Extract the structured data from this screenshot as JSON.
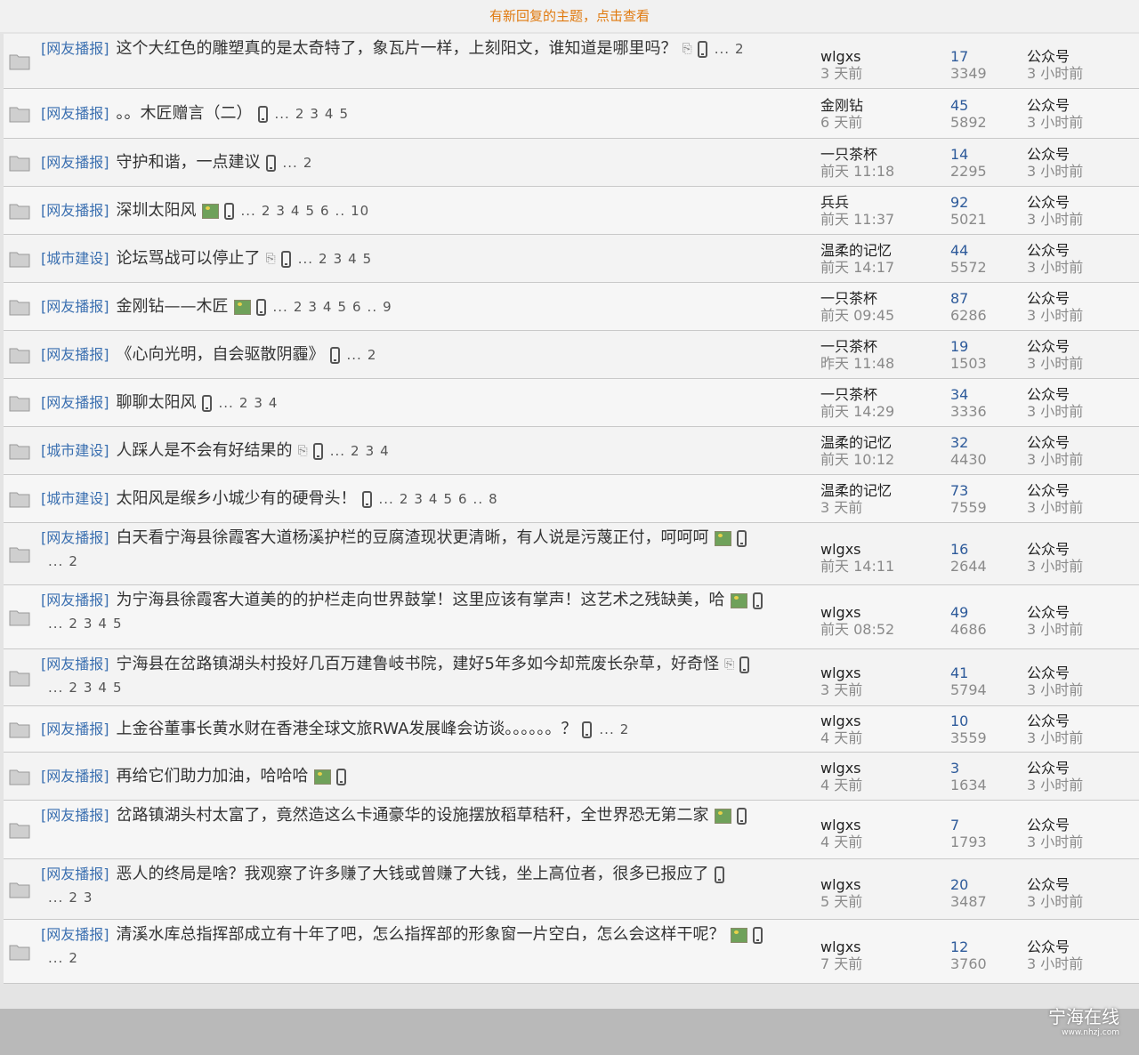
{
  "notice": "有新回复的主题，点击查看",
  "threads": [
    {
      "category": "[网友播报]",
      "title": "这个大红色的雕塑真的是太奇特了，象瓦片一样，上刻阳文，谁知道是哪里吗？",
      "icons": [
        "clip",
        "phone"
      ],
      "pages": [
        "...",
        "2"
      ],
      "author": "wlgxs",
      "author_time": "3 天前",
      "replies": "17",
      "views": "3349",
      "last_user": "公众号",
      "last_time": "3 小时前"
    },
    {
      "category": "[网友播报]",
      "title": "。。木匠赠言（二）",
      "icons": [
        "phone"
      ],
      "pages": [
        "...",
        "2",
        "3",
        "4",
        "5"
      ],
      "author": "金刚钻",
      "author_time": "6 天前",
      "replies": "45",
      "views": "5892",
      "last_user": "公众号",
      "last_time": "3 小时前"
    },
    {
      "category": "[网友播报]",
      "title": "守护和谐，一点建议",
      "icons": [
        "phone"
      ],
      "pages": [
        "...",
        "2"
      ],
      "author": "一只茶杯",
      "author_time": "前天 11:18",
      "replies": "14",
      "views": "2295",
      "last_user": "公众号",
      "last_time": "3 小时前"
    },
    {
      "category": "[网友播报]",
      "title": "深圳太阳风",
      "icons": [
        "img",
        "phone"
      ],
      "pages": [
        "...",
        "2",
        "3",
        "4",
        "5",
        "6",
        "..",
        "10"
      ],
      "author": "兵兵",
      "author_time": "前天 11:37",
      "replies": "92",
      "views": "5021",
      "last_user": "公众号",
      "last_time": "3 小时前"
    },
    {
      "category": "[城市建设]",
      "title": "论坛骂战可以停止了",
      "icons": [
        "clip",
        "phone"
      ],
      "pages": [
        "...",
        "2",
        "3",
        "4",
        "5"
      ],
      "author": "温柔的记忆",
      "author_time": "前天 14:17",
      "replies": "44",
      "views": "5572",
      "last_user": "公众号",
      "last_time": "3 小时前"
    },
    {
      "category": "[网友播报]",
      "title": "金刚钻——木匠",
      "icons": [
        "img",
        "phone"
      ],
      "pages": [
        "...",
        "2",
        "3",
        "4",
        "5",
        "6",
        "..",
        "9"
      ],
      "author": "一只茶杯",
      "author_time": "前天 09:45",
      "replies": "87",
      "views": "6286",
      "last_user": "公众号",
      "last_time": "3 小时前"
    },
    {
      "category": "[网友播报]",
      "title": "《心向光明，自会驱散阴霾》",
      "icons": [
        "phone"
      ],
      "pages": [
        "...",
        "2"
      ],
      "author": "一只茶杯",
      "author_time": "昨天 11:48",
      "replies": "19",
      "views": "1503",
      "last_user": "公众号",
      "last_time": "3 小时前"
    },
    {
      "category": "[网友播报]",
      "title": "聊聊太阳风",
      "icons": [
        "phone"
      ],
      "pages": [
        "...",
        "2",
        "3",
        "4"
      ],
      "author": "一只茶杯",
      "author_time": "前天 14:29",
      "replies": "34",
      "views": "3336",
      "last_user": "公众号",
      "last_time": "3 小时前"
    },
    {
      "category": "[城市建设]",
      "title": "人踩人是不会有好结果的",
      "icons": [
        "clip",
        "phone"
      ],
      "pages": [
        "...",
        "2",
        "3",
        "4"
      ],
      "author": "温柔的记忆",
      "author_time": "前天 10:12",
      "replies": "32",
      "views": "4430",
      "last_user": "公众号",
      "last_time": "3 小时前"
    },
    {
      "category": "[城市建设]",
      "title": "太阳风是缑乡小城少有的硬骨头！",
      "icons": [
        "phone"
      ],
      "pages": [
        "...",
        "2",
        "3",
        "4",
        "5",
        "6",
        "..",
        "8"
      ],
      "author": "温柔的记忆",
      "author_time": "3 天前",
      "replies": "73",
      "views": "7559",
      "last_user": "公众号",
      "last_time": "3 小时前"
    },
    {
      "category": "[网友播报]",
      "title": "白天看宁海县徐霞客大道杨溪护栏的豆腐渣现状更清晰，有人说是污蔑正付，呵呵呵",
      "icons": [
        "img",
        "phone"
      ],
      "pages": [
        "...",
        "2"
      ],
      "author": "wlgxs",
      "author_time": "前天 14:11",
      "replies": "16",
      "views": "2644",
      "last_user": "公众号",
      "last_time": "3 小时前"
    },
    {
      "category": "[网友播报]",
      "title": "为宁海县徐霞客大道美的的护栏走向世界鼓掌！这里应该有掌声！这艺术之残缺美，哈",
      "icons": [
        "img",
        "phone"
      ],
      "pages": [
        "...",
        "2",
        "3",
        "4",
        "5"
      ],
      "author": "wlgxs",
      "author_time": "前天 08:52",
      "replies": "49",
      "views": "4686",
      "last_user": "公众号",
      "last_time": "3 小时前"
    },
    {
      "category": "[网友播报]",
      "title": "宁海县在岔路镇湖头村投好几百万建鲁岐书院，建好5年多如今却荒废长杂草，好奇怪",
      "icons": [
        "clip",
        "phone"
      ],
      "pages": [
        "...",
        "2",
        "3",
        "4",
        "5"
      ],
      "author": "wlgxs",
      "author_time": "3 天前",
      "replies": "41",
      "views": "5794",
      "last_user": "公众号",
      "last_time": "3 小时前"
    },
    {
      "category": "[网友播报]",
      "title": "上金谷董事长黄水财在香港全球文旅RWA发展峰会访谈。。。。。。？",
      "icons": [
        "phone"
      ],
      "pages": [
        "...",
        "2"
      ],
      "author": "wlgxs",
      "author_time": "4 天前",
      "replies": "10",
      "views": "3559",
      "last_user": "公众号",
      "last_time": "3 小时前"
    },
    {
      "category": "[网友播报]",
      "title": "再给它们助力加油，哈哈哈",
      "icons": [
        "img",
        "phone"
      ],
      "pages": [],
      "author": "wlgxs",
      "author_time": "4 天前",
      "replies": "3",
      "views": "1634",
      "last_user": "公众号",
      "last_time": "3 小时前"
    },
    {
      "category": "[网友播报]",
      "title": "岔路镇湖头村太富了，竟然造这么卡通豪华的设施摆放稻草秸秆，全世界恐无第二家",
      "icons": [
        "img",
        "phone"
      ],
      "pages": [],
      "author": "wlgxs",
      "author_time": "4 天前",
      "replies": "7",
      "views": "1793",
      "last_user": "公众号",
      "last_time": "3 小时前"
    },
    {
      "category": "[网友播报]",
      "title": "恶人的终局是啥？我观察了许多赚了大钱或曾赚了大钱，坐上高位者，很多已报应了",
      "icons": [
        "phone"
      ],
      "pages": [
        "...",
        "2",
        "3"
      ],
      "author": "wlgxs",
      "author_time": "5 天前",
      "replies": "20",
      "views": "3487",
      "last_user": "公众号",
      "last_time": "3 小时前"
    },
    {
      "category": "[网友播报]",
      "title": "清溪水库总指挥部成立有十年了吧，怎么指挥部的形象窗一片空白，怎么会这样干呢？",
      "icons": [
        "img",
        "phone"
      ],
      "pages": [
        "...",
        "2"
      ],
      "author": "wlgxs",
      "author_time": "7 天前",
      "replies": "12",
      "views": "3760",
      "last_user": "公众号",
      "last_time": "3 小时前"
    }
  ],
  "watermark": {
    "name": "宁海在线",
    "url": "www.nhzj.com"
  },
  "colors": {
    "category": "#3a6fb0",
    "notice": "#e07a10",
    "replies": "#2d5a9a"
  }
}
